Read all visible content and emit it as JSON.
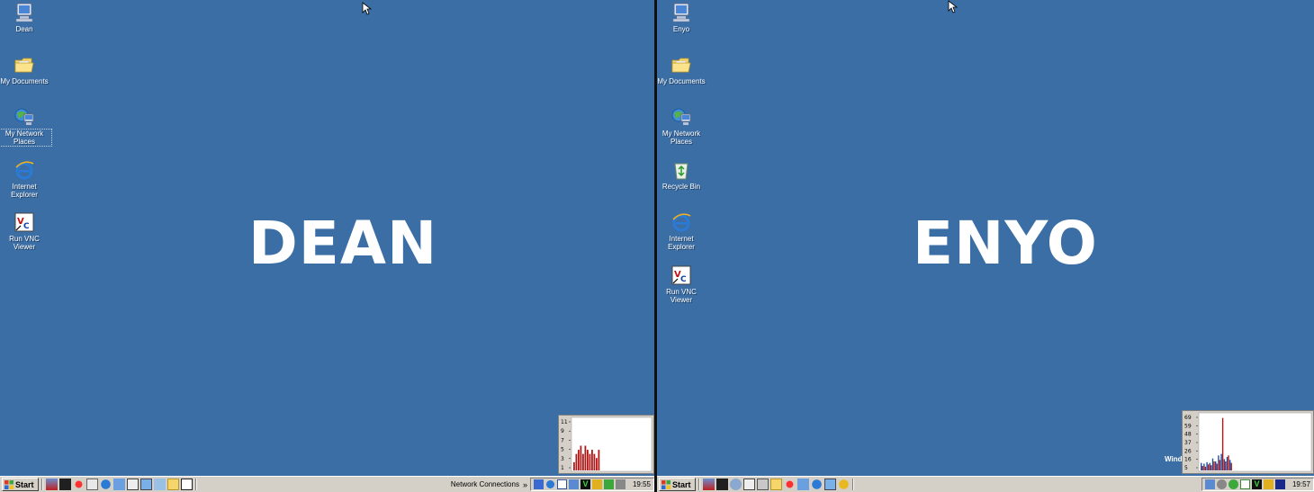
{
  "left": {
    "machine_name": "DEAN",
    "icons": [
      {
        "label": "Dean"
      },
      {
        "label": "My Documents"
      },
      {
        "label": "My Network Places"
      },
      {
        "label": "Internet Explorer"
      },
      {
        "label": "Run VNC Viewer"
      }
    ],
    "taskbar": {
      "start_label": "Start",
      "network_label": "Network Connections",
      "chevron": "»",
      "clock": "19:55"
    },
    "graph": {
      "ticks": [
        "11",
        "9",
        "7",
        "5",
        "3",
        "1"
      ],
      "values": [
        2,
        4,
        5,
        6,
        4,
        6,
        5,
        4,
        5,
        4,
        3,
        5
      ],
      "color": "#b01818"
    }
  },
  "right": {
    "machine_name": "ENYO",
    "icons": [
      {
        "label": "Enyo"
      },
      {
        "label": "My Documents"
      },
      {
        "label": "My Network Places"
      },
      {
        "label": "Recycle Bin"
      },
      {
        "label": "Internet Explorer"
      },
      {
        "label": "Run VNC Viewer"
      }
    ],
    "taskbar": {
      "start_label": "Start",
      "clock": "19:57"
    },
    "overlay_text": "Wind",
    "graph": {
      "ticks": [
        "69",
        "59",
        "48",
        "37",
        "26",
        "16",
        "5"
      ],
      "series": [
        {
          "color": "#1f4fa8",
          "values": [
            10,
            9,
            11,
            10,
            16,
            12,
            20,
            22,
            15,
            18,
            14
          ]
        },
        {
          "color": "#b01818",
          "values": [
            6,
            5,
            8,
            7,
            12,
            9,
            14,
            70,
            12,
            20,
            10
          ]
        }
      ]
    }
  },
  "colors": {
    "desktop": "#3a6ea5",
    "taskbar": "#d4d0c8"
  }
}
